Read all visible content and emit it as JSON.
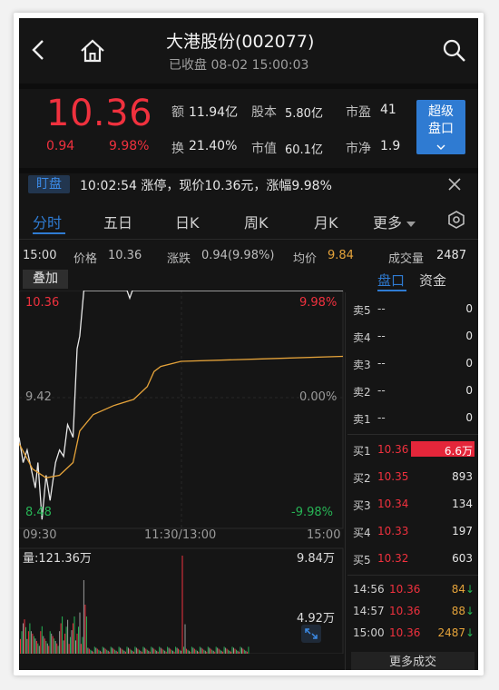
{
  "header": {
    "title": "大港股份(002077)",
    "subtitle": "已收盘 08-02 15:00:03"
  },
  "quote": {
    "price": "10.36",
    "change": "0.94",
    "change_pct": "9.98%",
    "amount_label": "额",
    "amount": "11.94亿",
    "share_cap_label": "股本",
    "share_cap": "5.80亿",
    "pe_label": "市盈",
    "pe": "41",
    "turnover_label": "换",
    "turnover": "21.40%",
    "mkt_cap_label": "市值",
    "mkt_cap": "60.1亿",
    "pb_label": "市净",
    "pb": "1.9",
    "badge_line1": "超级",
    "badge_line2": "盘口"
  },
  "alert": {
    "tag": "盯盘",
    "text": "10:02:54 涨停，现价10.36元，涨幅9.98%"
  },
  "tabs": [
    "分时",
    "五日",
    "日K",
    "周K",
    "月K",
    "更多"
  ],
  "info_bar": {
    "time": "15:00",
    "price_label": "价格",
    "price": "10.36",
    "chg_label": "涨跌",
    "chg": "0.94(9.98%)",
    "avg_label": "均价",
    "avg": "9.84",
    "vol_label": "成交量",
    "vol": "2487"
  },
  "overlay_button": "叠加",
  "side_tabs": [
    "盘口",
    "资金"
  ],
  "chart_axis": {
    "y_top": "10.36",
    "y_mid": "9.42",
    "y_bottom": "8.48",
    "pct_top": "9.98%",
    "pct_mid": "0.00%",
    "pct_bottom": "-9.98%",
    "x_start": "09:30",
    "x_mid": "11:30/13:00",
    "x_end": "15:00"
  },
  "volume": {
    "label": "量:121.36万",
    "top": "9.84万",
    "mid": "4.92万"
  },
  "order_book": {
    "asks": [
      {
        "label": "卖5",
        "price": "--",
        "vol": "0"
      },
      {
        "label": "卖4",
        "price": "--",
        "vol": "0"
      },
      {
        "label": "卖3",
        "price": "--",
        "vol": "0"
      },
      {
        "label": "卖2",
        "price": "--",
        "vol": "0"
      },
      {
        "label": "卖1",
        "price": "--",
        "vol": "0"
      }
    ],
    "bids": [
      {
        "label": "买1",
        "price": "10.36",
        "vol": "6.6万"
      },
      {
        "label": "买2",
        "price": "10.35",
        "vol": "893"
      },
      {
        "label": "买3",
        "price": "10.34",
        "vol": "134"
      },
      {
        "label": "买4",
        "price": "10.33",
        "vol": "197"
      },
      {
        "label": "买5",
        "price": "10.32",
        "vol": "603"
      }
    ]
  },
  "trades": [
    {
      "time": "14:56",
      "price": "10.36",
      "vol": "84"
    },
    {
      "time": "14:57",
      "price": "10.36",
      "vol": "88"
    },
    {
      "time": "15:00",
      "price": "10.36",
      "vol": "2487"
    }
  ],
  "more_trades": "更多成交",
  "colors": {
    "up": "#f0313e",
    "down": "#27b455",
    "accent": "#2f7bd2",
    "avg_line": "#e5a33a"
  },
  "icons": [
    "back-chevron-icon",
    "home-icon",
    "search-icon",
    "close-icon",
    "settings-hexagon-icon",
    "expand-arrows-icon",
    "chevron-down-icon",
    "dropdown-triangle-icon"
  ]
}
